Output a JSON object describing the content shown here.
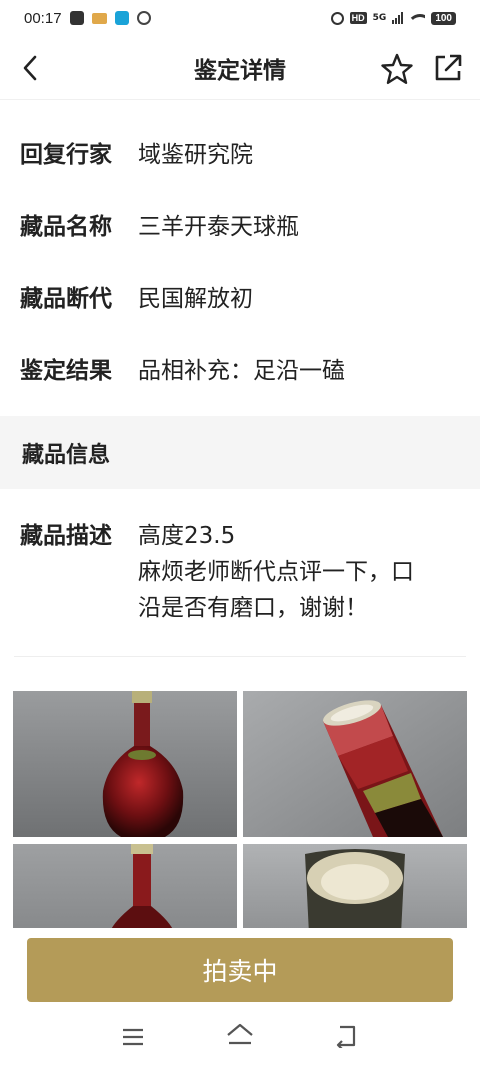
{
  "status_bar": {
    "time": "00:17",
    "hd": "HD",
    "network": "5G",
    "battery": "100"
  },
  "header": {
    "title": "鉴定详情"
  },
  "info_rows": [
    {
      "label": "回复行家",
      "value": "域鉴研究院"
    },
    {
      "label": "藏品名称",
      "value": "三羊开泰天球瓶"
    },
    {
      "label": "藏品断代",
      "value": "民国解放初"
    },
    {
      "label": "鉴定结果",
      "value": "品相补充：足沿一磕"
    }
  ],
  "section": {
    "title": "藏品信息"
  },
  "description": {
    "label": "藏品描述",
    "lines": [
      "高度23.5",
      "麻烦老师断代点评一下，口",
      "沿是否有磨口，谢谢！"
    ]
  },
  "action": {
    "button_label": "拍卖中"
  },
  "icons": {
    "back": "back-arrow-icon",
    "favorite": "star-icon",
    "share": "share-icon"
  },
  "colors": {
    "accent": "#b49b58",
    "section_bg": "#f5f5f5"
  }
}
